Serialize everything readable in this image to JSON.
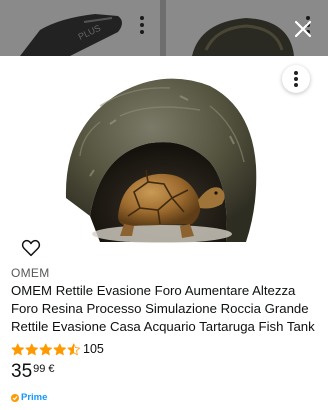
{
  "background": {
    "card_text": "PLUS"
  },
  "product": {
    "brand": "OMEM",
    "title": "OMEM Rettile Evasione Foro Aumentare Altezza Foro Resina Processo Simulazione Roccia Grande Rettile Evasione Casa Acquario Tartaruga Fish Tank",
    "rating": 4.5,
    "rating_max": 5,
    "review_count": "105",
    "price_whole": "35",
    "price_fraction": "99",
    "currency": "€",
    "prime_label": "Prime"
  },
  "icons": {
    "close": "close-icon",
    "more": "more-options-icon",
    "wishlist": "heart-icon",
    "prime": "prime-check-icon"
  },
  "colors": {
    "star": "#ff9900",
    "prime": "#1399ff",
    "prime_badge": "#ff9900",
    "overlay": "#6e6e6e"
  }
}
